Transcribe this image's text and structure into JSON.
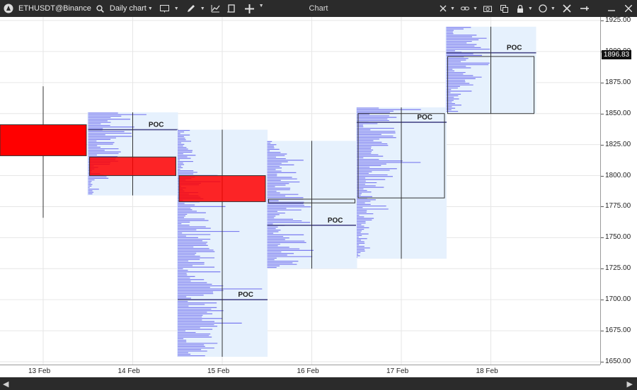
{
  "toolbar": {
    "symbol": "ETHUSDT@Binance",
    "timeframe": "Daily chart",
    "window_title": "Chart",
    "icons": [
      "logo-icon",
      "search-icon",
      "window-icon",
      "pencil-icon",
      "indicator-icon",
      "bracket-icon",
      "crosshair-icon",
      "cursor-icon",
      "link-icon",
      "camera-icon",
      "copy-icon",
      "lock-icon",
      "circle-icon",
      "tools-icon",
      "pin-icon",
      "minimize-icon",
      "close-icon"
    ]
  },
  "price_axis": {
    "labels": [
      "1925.00",
      "1900.00",
      "1875.00",
      "1850.00",
      "1825.00",
      "1800.00",
      "1775.00",
      "1750.00",
      "1725.00",
      "1700.00",
      "1675.00",
      "1650.00"
    ],
    "last_price": "1896.83"
  },
  "time_axis": {
    "labels": [
      "13 Feb",
      "14 Feb",
      "15 Feb",
      "16 Feb",
      "17 Feb",
      "18 Feb"
    ]
  },
  "chart_data": {
    "type": "candlestick-volume-profile",
    "symbol": "ETHUSDT@Binance",
    "timeframe": "Daily",
    "ylim": [
      1650,
      1925
    ],
    "poc_label": "POC",
    "days": [
      {
        "date": "13 Feb",
        "open": 1841,
        "close": 1816,
        "high": 1872,
        "low": 1766,
        "poc": null,
        "profile": false
      },
      {
        "date": "14 Feb",
        "open": 1815,
        "close": 1800,
        "high": 1851,
        "low": 1784,
        "poc": 1837,
        "profile": true
      },
      {
        "date": "15 Feb",
        "open": 1800,
        "close": 1779,
        "high": 1837,
        "low": 1654,
        "poc": 1700,
        "profile": true
      },
      {
        "date": "16 Feb",
        "open": 1781,
        "close": 1778,
        "high": 1828,
        "low": 1725,
        "poc": 1760,
        "profile": true
      },
      {
        "date": "17 Feb",
        "open": 1850,
        "close": 1782,
        "high": 1855,
        "low": 1733,
        "poc": 1843,
        "profile": true
      },
      {
        "date": "18 Feb",
        "open": 1896,
        "close": 1850,
        "high": 1920,
        "low": 1850,
        "poc": 1899,
        "profile": true
      }
    ],
    "colors": {
      "bearish": "#ff0000",
      "profile_bg": "#e6f1fd",
      "profile_bar": "#7b7bf0",
      "poc_line": "#4a4a8a",
      "grid": "#e6e6e6",
      "candle_border": "#333333"
    }
  }
}
